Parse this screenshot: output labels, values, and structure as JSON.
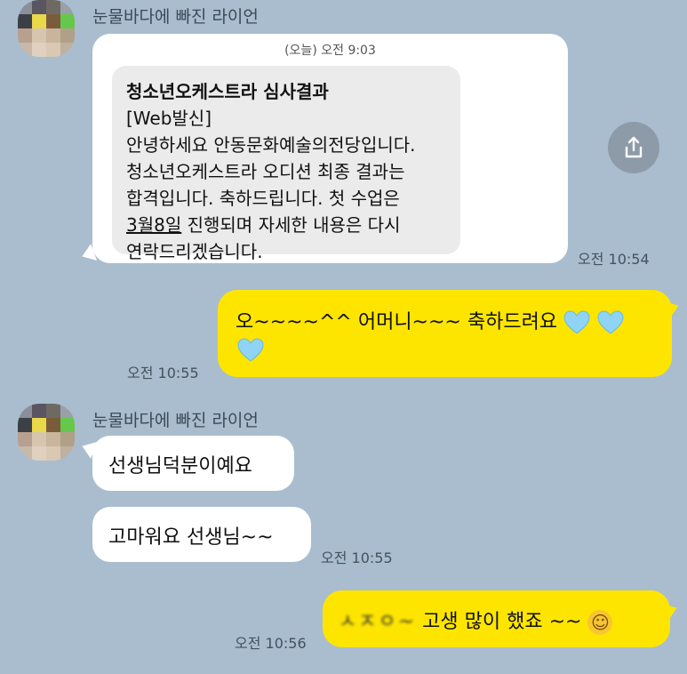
{
  "chat": {
    "sender_name": "눈물바다에 빠진 라이언",
    "sms_message": {
      "date_label": "(오늘) 오전 9:03",
      "title_line1": "청소년오케스트라 심사결과",
      "title_line2": "[Web발신]",
      "body_line1": "안녕하세요 안동문화예술의전당입니다.",
      "body_line2": "청소년오케스트라 오디션 최종 결과는",
      "body_line3": "합격입니다. 축하드립니다. 첫 수업은",
      "body_line4_date": "3월8일",
      "body_line4_rest": " 진행되며 자세한 내용은 다시",
      "body_line5": "연락드리겠습니다.",
      "time": "오전 10:54"
    },
    "my_message_1": {
      "line1": "오~~~~^^ 어머니~~~ 축하드려요",
      "time": "오전 10:55"
    },
    "sender_name_2": "눈물바다에 빠진 라이언",
    "their_message_1": {
      "text": "선생님덕분이예요"
    },
    "their_message_2": {
      "text": "고마워요 선생님~~",
      "time": "오전 10:55"
    },
    "my_message_2": {
      "blurred_prefix": "ㅅㅈㅇ~",
      "text": "고생 많이 했죠 ~~",
      "emoji": "☺",
      "time": "오전 10:56"
    }
  },
  "icons": {
    "share": "share-icon",
    "heart": "heart-icon",
    "avatar": "avatar-image"
  },
  "colors": {
    "background": "#a9bdce",
    "my_bubble": "#fee500",
    "their_bubble": "#ffffff",
    "heart": "#8fd3f5"
  }
}
